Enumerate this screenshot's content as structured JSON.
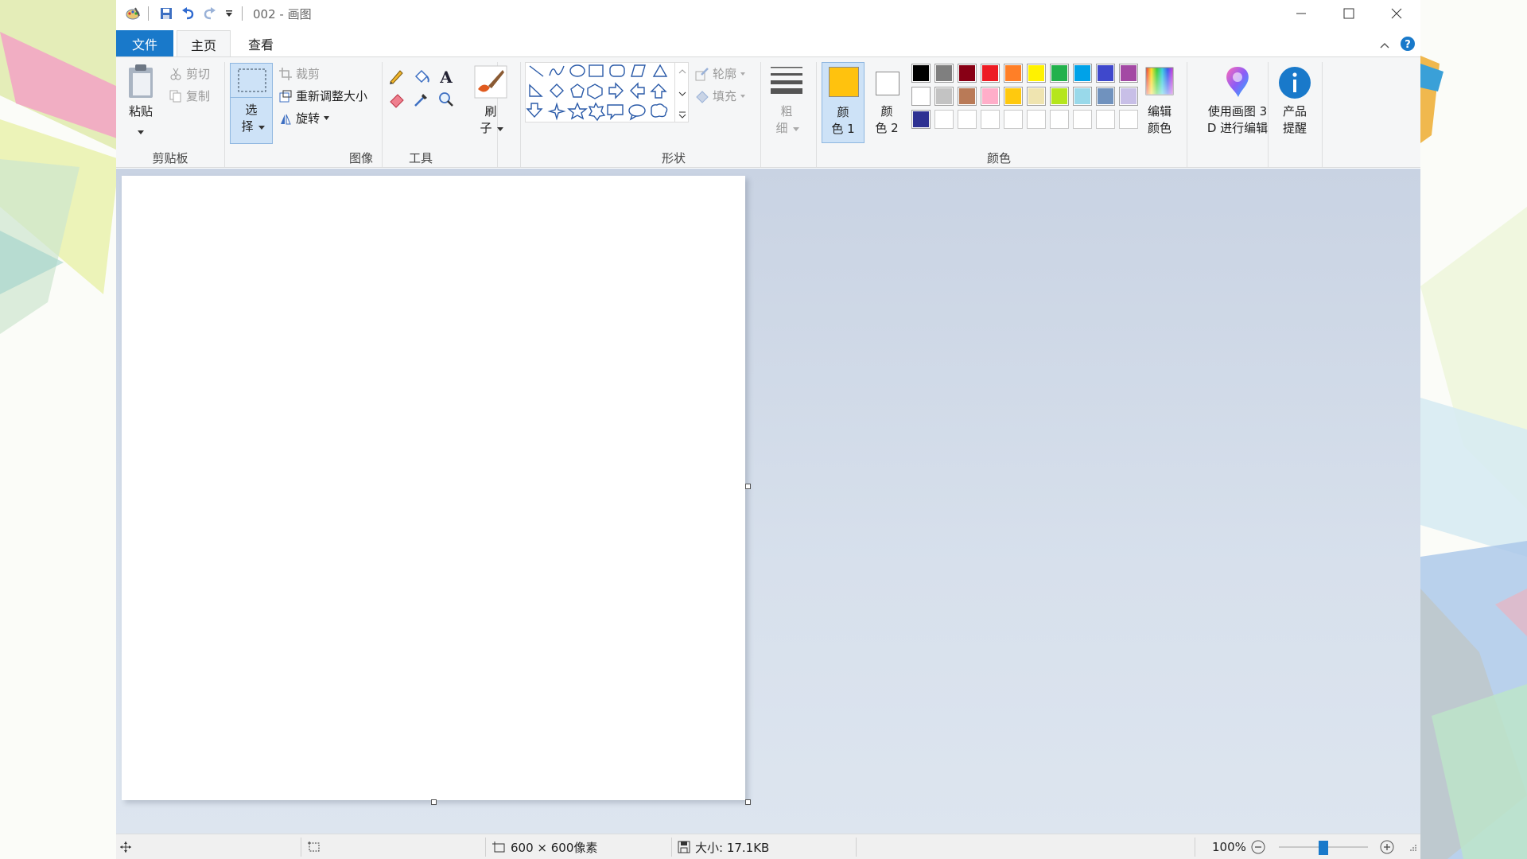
{
  "titlebar": {
    "title": "002 - 画图"
  },
  "tabs": {
    "file": "文件",
    "home": "主页",
    "view": "查看"
  },
  "clipboard": {
    "paste": "粘贴",
    "cut": "剪切",
    "copy": "复制",
    "group": "剪贴板"
  },
  "image": {
    "select_1": "选",
    "select_2": "择",
    "crop": "裁剪",
    "resize": "重新调整大小",
    "rotate": "旋转",
    "group": "图像"
  },
  "tools": {
    "group": "工具"
  },
  "brushes": {
    "label_1": "刷",
    "label_2": "子"
  },
  "shapes": {
    "outline": "轮廓",
    "fill": "填充",
    "group": "形状"
  },
  "size": {
    "label_1": "粗",
    "label_2": "细"
  },
  "colors": {
    "color1_1": "颜",
    "color1_2": "色 1",
    "color2_1": "颜",
    "color2_2": "色 2",
    "edit_1": "编辑",
    "edit_2": "颜色",
    "group": "颜色",
    "color1_value": "#ffc20e",
    "color2_value": "#ffffff",
    "palette_row1": [
      "#000000",
      "#7f7f7f",
      "#880015",
      "#ed1c24",
      "#ff7f27",
      "#fff200",
      "#22b14c",
      "#00a2e8",
      "#3f48cc",
      "#a349a4"
    ],
    "palette_row2": [
      "#ffffff",
      "#c3c3c3",
      "#b97a57",
      "#ffaec9",
      "#ffc90e",
      "#efe4b0",
      "#b5e61d",
      "#99d9ea",
      "#7092be",
      "#c8bfe7"
    ],
    "palette_row3": [
      "#2e3192",
      "#ffffff",
      "#ffffff",
      "#ffffff",
      "#ffffff",
      "#ffffff",
      "#ffffff",
      "#ffffff",
      "#ffffff",
      "#ffffff"
    ]
  },
  "paint3d": {
    "label_1": "使用画图 3",
    "label_2": "D 进行编辑"
  },
  "product": {
    "label_1": "产品",
    "label_2": "提醒"
  },
  "status": {
    "dimensions": "600 × 600像素",
    "size": "大小: 17.1KB",
    "zoom": "100%"
  }
}
